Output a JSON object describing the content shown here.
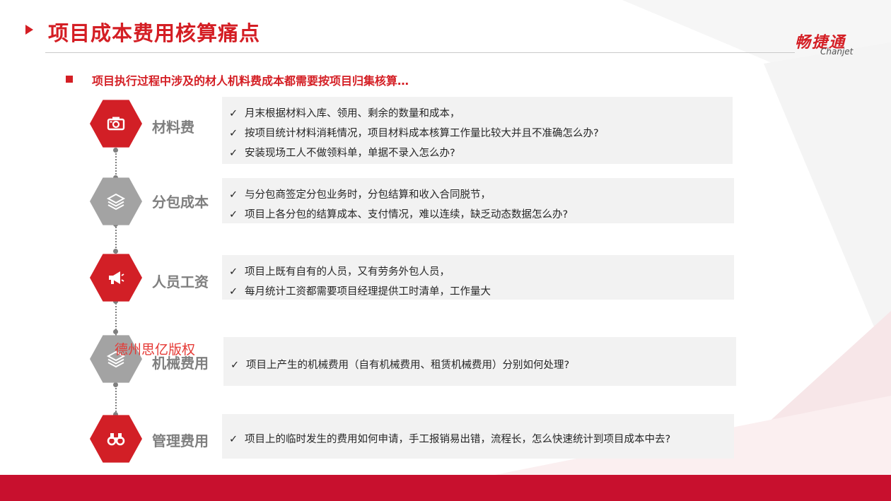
{
  "title": "项目成本费用核算痛点",
  "logo": {
    "cn": "畅捷通",
    "en": "Chanjet"
  },
  "subheading": "项目执行过程中涉及的材人机料费成本都需要按项目归集核算…",
  "watermark": "德州思亿版权",
  "check_glyph": "✓",
  "colors": {
    "accent": "#d41e24",
    "hex_gray": "#a3a3a3",
    "box_bg": "#f2f2f2",
    "label_gray": "#7f7f7f"
  },
  "categories": [
    {
      "label": "材料费",
      "icon": "camera-icon",
      "hex_color": "red",
      "bullets": [
        "月末根据材料入库、领用、剩余的数量和成本，",
        "按项目统计材料消耗情况，项目材料成本核算工作量比较大并且不准确怎么办?",
        "安装现场工人不做领料单，单据不录入怎么办?"
      ]
    },
    {
      "label": "分包成本",
      "icon": "layers-icon",
      "hex_color": "gray",
      "bullets": [
        "与分包商签定分包业务时，分包结算和收入合同脱节，",
        "项目上各分包的结算成本、支付情况，难以连续，缺乏动态数据怎么办?"
      ]
    },
    {
      "label": "人员工资",
      "icon": "megaphone-icon",
      "hex_color": "red",
      "bullets": [
        "项目上既有自有的人员，又有劳务外包人员，",
        "每月统计工资都需要项目经理提供工时清单，工作量大"
      ]
    },
    {
      "label": "机械费用",
      "icon": "layers-icon",
      "hex_color": "gray",
      "bullets": [
        "项目上产生的机械费用（自有机械费用、租赁机械费用）分别如何处理?"
      ]
    },
    {
      "label": "管理费用",
      "icon": "binoculars-icon",
      "hex_color": "red",
      "bullets": [
        "项目上的临时发生的费用如何申请，手工报销易出错，流程长，怎么快速统计到项目成本中去?"
      ]
    }
  ]
}
